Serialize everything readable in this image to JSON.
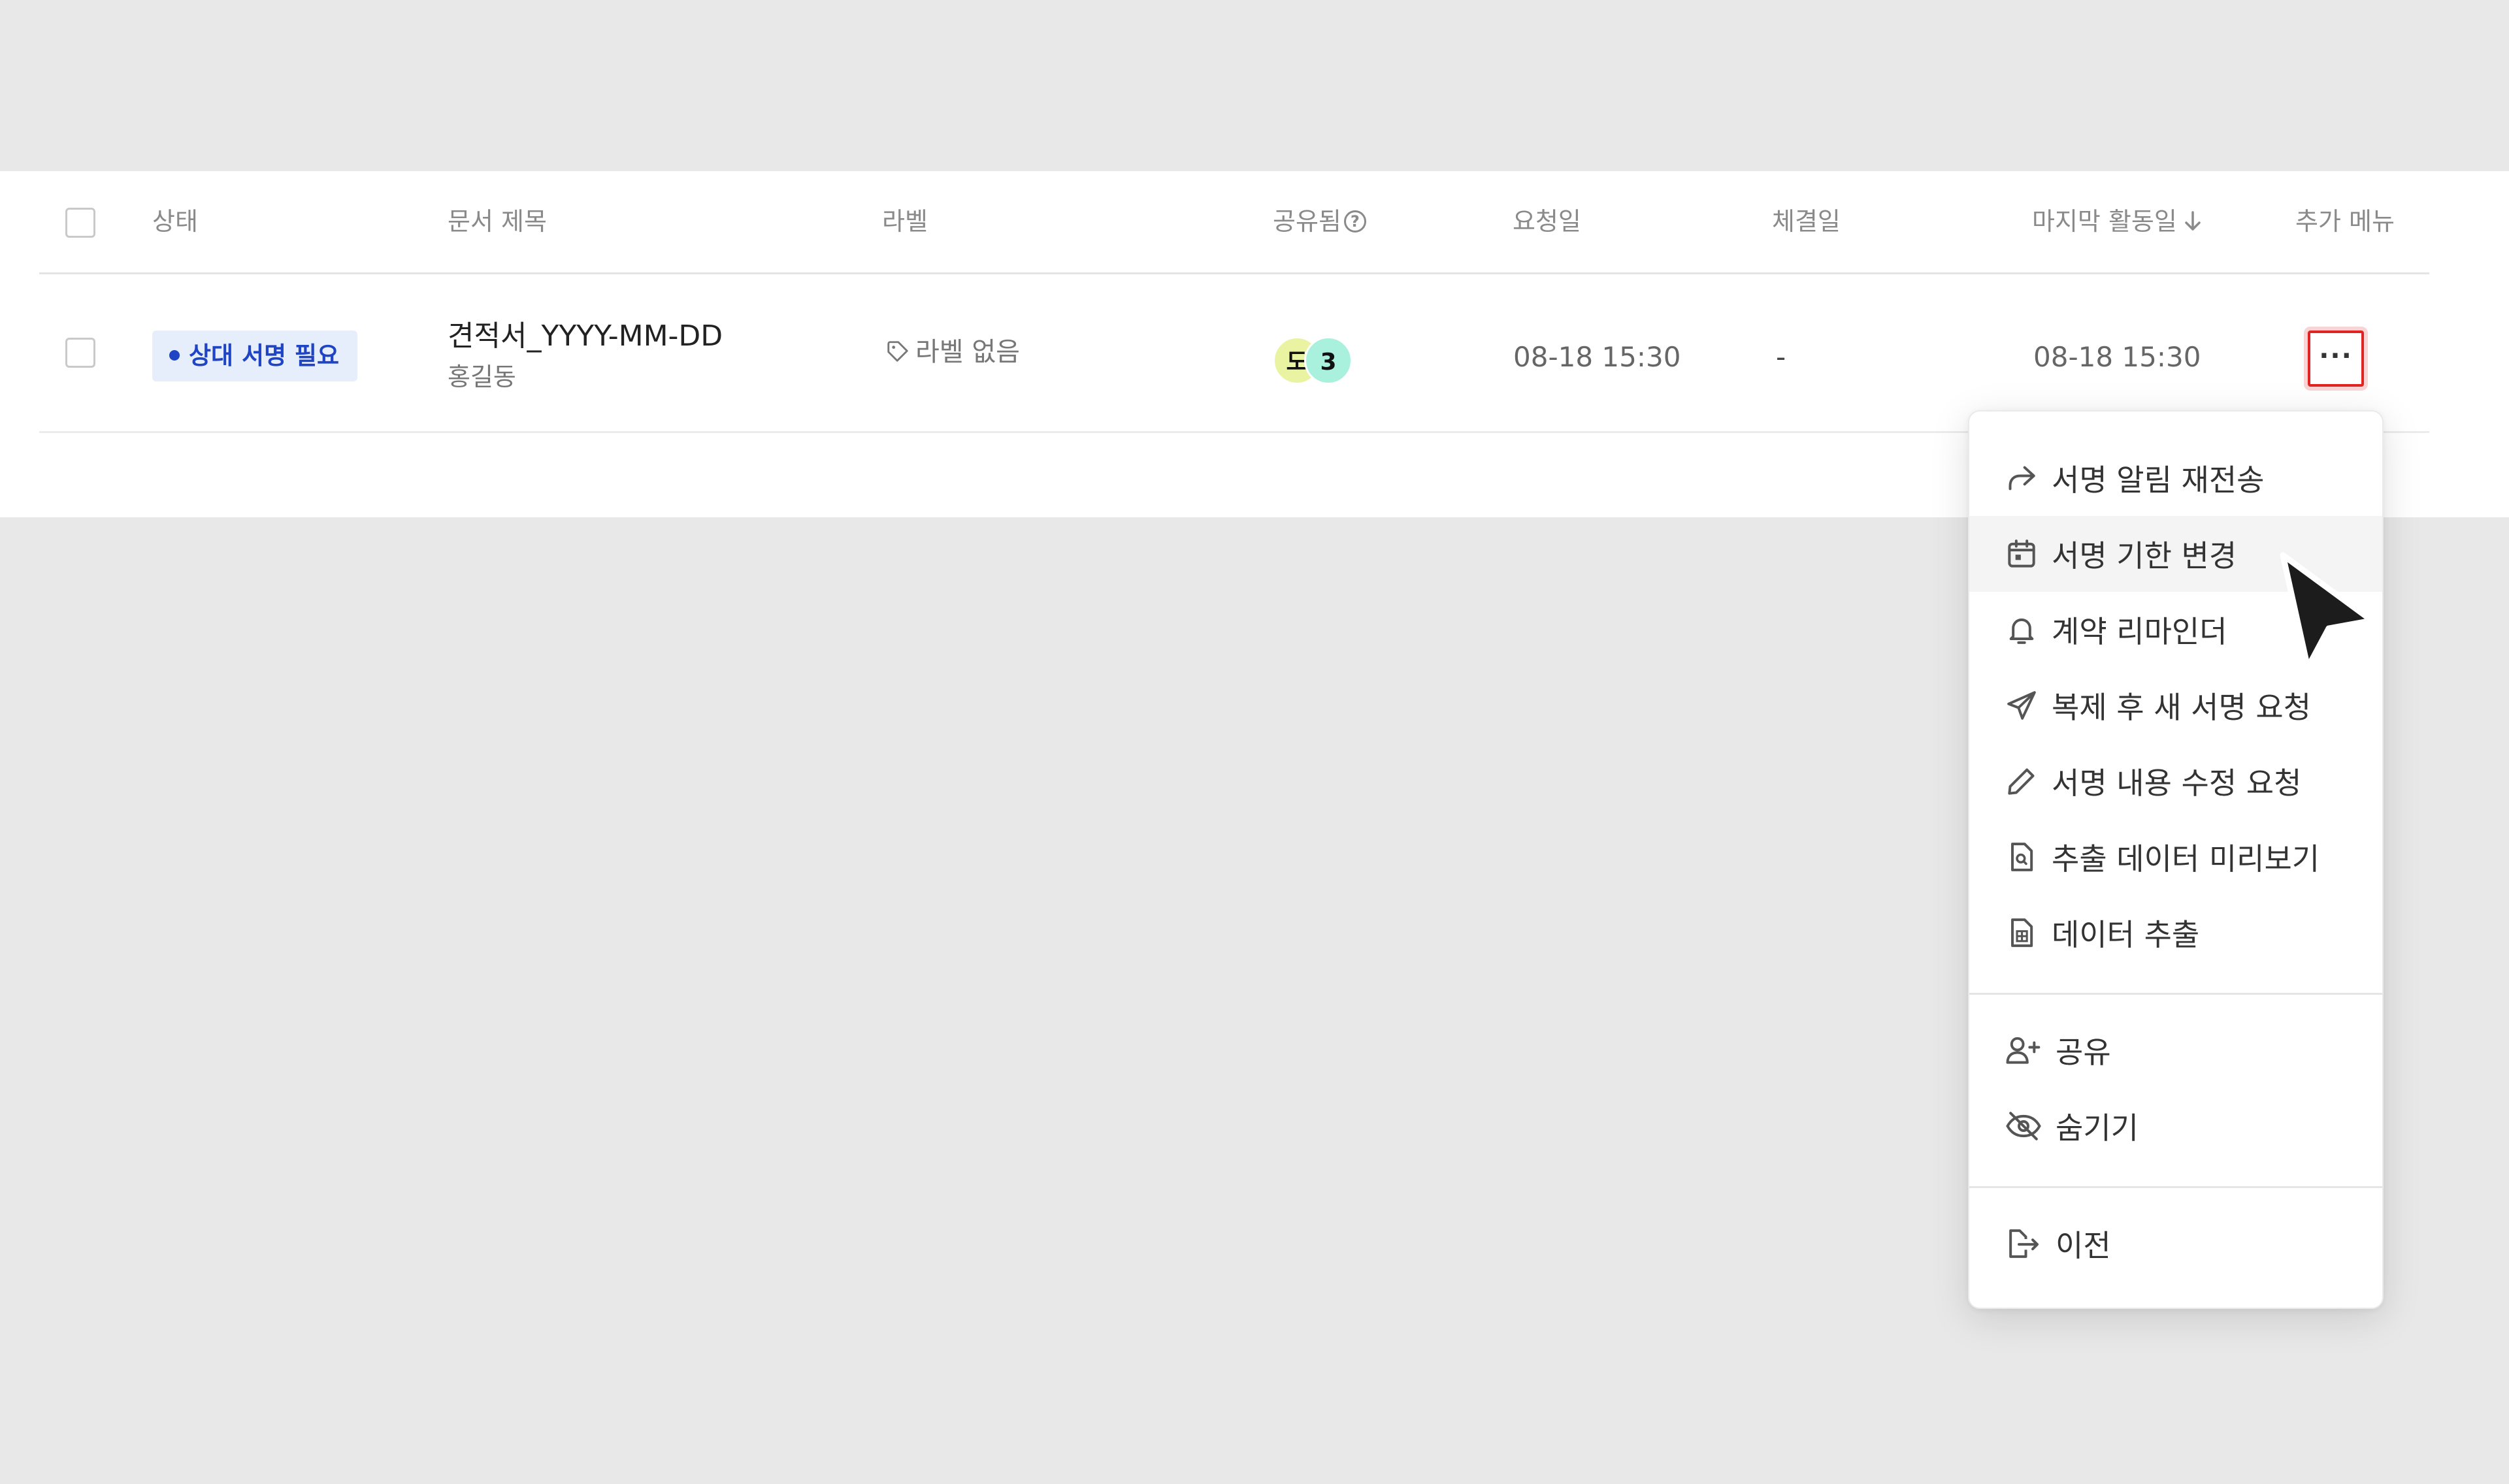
{
  "table": {
    "headers": {
      "status": "상태",
      "doc_title": "문서 제목",
      "label": "라벨",
      "shared": "공유됨",
      "requested": "요청일",
      "concluded": "체결일",
      "last_activity": "마지막 활동일",
      "more_menu": "추가 메뉴"
    },
    "row": {
      "status": "상대 서명 필요",
      "doc_title": "견적서_YYYY-MM-DD",
      "owner": "홍길동",
      "label": "라벨 없음",
      "shared_avatar_initial": "도",
      "shared_count": "3",
      "requested": "08-18 15:30",
      "concluded": "-",
      "last_activity": "08-18 15:30",
      "more_symbol": "···"
    }
  },
  "menu": {
    "items": [
      {
        "label": "서명 알림 재전송",
        "icon": "share-forward-icon"
      },
      {
        "label": "서명 기한 변경",
        "icon": "calendar-icon"
      },
      {
        "label": "계약 리마인더",
        "icon": "bell-icon"
      },
      {
        "label": "복제 후 새 서명 요청",
        "icon": "paper-plane-icon"
      },
      {
        "label": "서명 내용 수정 요청",
        "icon": "pencil-icon"
      },
      {
        "label": "추출 데이터 미리보기",
        "icon": "document-search-icon"
      },
      {
        "label": "데이터 추출",
        "icon": "document-table-icon"
      },
      {
        "label": "공유",
        "icon": "add-user-icon"
      },
      {
        "label": "숨기기",
        "icon": "eye-off-icon"
      },
      {
        "label": "이전",
        "icon": "document-export-icon"
      }
    ]
  },
  "colors": {
    "background": "#e8e8e8",
    "badge_bg": "#e6edfb",
    "badge_text": "#1f44c4",
    "highlight_border": "#e02424",
    "avatar_1": "#e9f3a1",
    "avatar_2": "#a9f1dd"
  }
}
